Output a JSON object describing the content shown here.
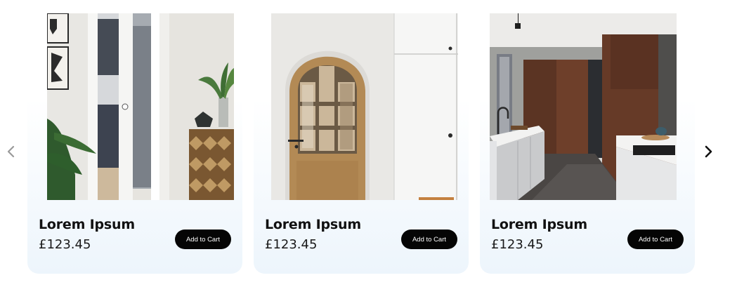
{
  "carousel": {
    "prev_icon": "chevron-left-icon",
    "next_icon": "chevron-right-icon",
    "prev_color": "#9a9a9a",
    "next_color": "#111111",
    "cards": [
      {
        "title": "Lorem Ipsum",
        "price": "£123.45",
        "button_label": "Add to Cart",
        "image": "interior-glass-sliding-door-photo"
      },
      {
        "title": "Lorem Ipsum",
        "price": "£123.45",
        "button_label": "Add to Cart",
        "image": "arched-oak-glazed-door-photo"
      },
      {
        "title": "Lorem Ipsum",
        "price": "£123.45",
        "button_label": "Add to Cart",
        "image": "modern-kitchen-walnut-door-photo"
      }
    ]
  },
  "colors": {
    "card_gradient_end": "#edf5fc",
    "button_bg": "#050505",
    "button_text": "#ffffff"
  }
}
